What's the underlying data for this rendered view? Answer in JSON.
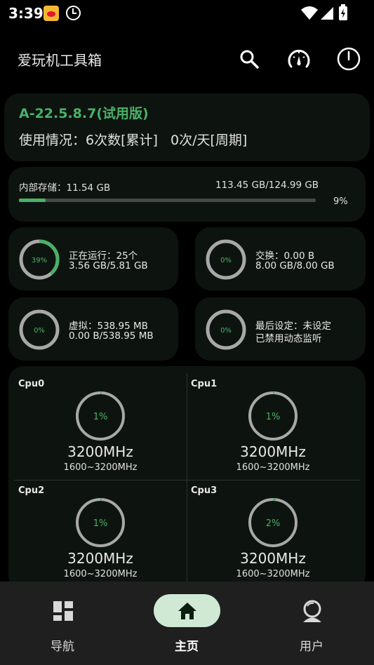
{
  "status_bar": {
    "time": "3:39",
    "icons": [
      "weibo-icon",
      "clock-icon",
      "wifi-icon",
      "signal-icon",
      "battery-charging-icon"
    ]
  },
  "app_bar": {
    "title": "爱玩机工具箱",
    "actions": [
      "search-icon",
      "gauge-icon",
      "power-icon"
    ]
  },
  "header": {
    "version": "A-22.5.8.7(试用版)",
    "usage": "使用情况：6次数[累计]   0次/天[周期]"
  },
  "storage": {
    "label": "内部存储：11.54 GB",
    "total": "113.45 GB/124.99 GB",
    "percent_text": "9%",
    "progress": 0.09
  },
  "stats": [
    {
      "ring_text": "39%",
      "ring_value": 0.39,
      "line1": "正在运行：25个",
      "line2": "3.56 GB/5.81 GB"
    },
    {
      "ring_text": "0%",
      "ring_value": 0.0,
      "line1": "交换：0.00 B",
      "line2": "8.00 GB/8.00 GB"
    },
    {
      "ring_text": "0%",
      "ring_value": 0.0,
      "line1": "虚拟：538.95 MB",
      "line2": "0.00 B/538.95 MB"
    },
    {
      "ring_text": "0%",
      "ring_value": 0.0,
      "line1": "最后设定：未设定",
      "line2": "已禁用动态监听"
    }
  ],
  "cpus": [
    {
      "name": "Cpu0",
      "usage_text": "1%",
      "usage": 0.01,
      "freq": "3200MHz",
      "range": "1600~3200MHz"
    },
    {
      "name": "Cpu1",
      "usage_text": "1%",
      "usage": 0.01,
      "freq": "3200MHz",
      "range": "1600~3200MHz"
    },
    {
      "name": "Cpu2",
      "usage_text": "1%",
      "usage": 0.01,
      "freq": "3200MHz",
      "range": "1600~3200MHz"
    },
    {
      "name": "Cpu3",
      "usage_text": "2%",
      "usage": 0.02,
      "freq": "3200MHz",
      "range": "1600~3200MHz"
    }
  ],
  "bottom_nav": [
    {
      "label": "导航",
      "icon": "dashboard-icon",
      "active": false
    },
    {
      "label": "主页",
      "icon": "home-icon",
      "active": true
    },
    {
      "label": "用户",
      "icon": "user-icon",
      "active": false
    }
  ],
  "colors": {
    "accent": "#4bb067",
    "ring_track": "#a8a8a8",
    "card": "#0d1410",
    "nav_pill": "#cfe9d4"
  }
}
